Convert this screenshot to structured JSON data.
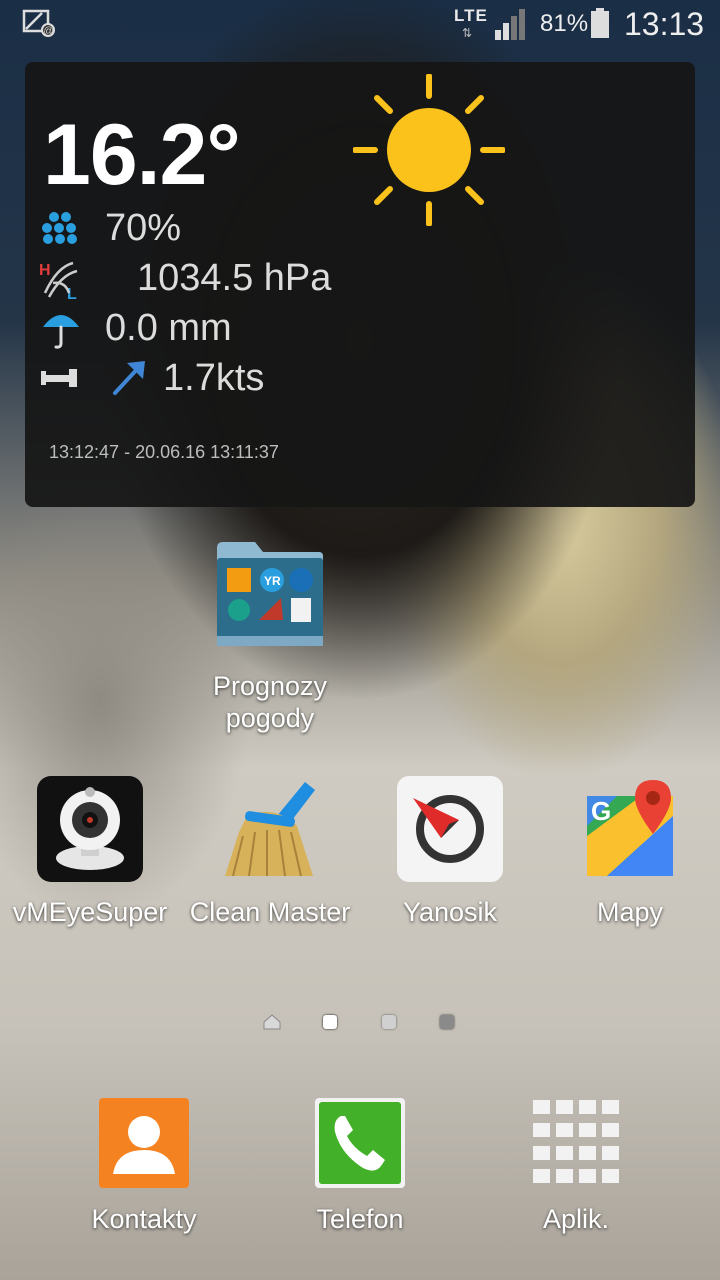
{
  "status_bar": {
    "network": "LTE",
    "network_arrows": "⇅",
    "battery_percent": "81%",
    "time": "13:13",
    "left_icon": "screen-mirroring-icon"
  },
  "weather_widget": {
    "temperature": "16.2°",
    "weather_icon": "sun-icon",
    "humidity": "70%",
    "pressure": "1034.5 hPa",
    "rain": "0.0 mm",
    "wind": "1.7kts",
    "footer": "13:12:47 - 20.06.16 13:11:37"
  },
  "home_folder": {
    "label_line1": "Prognozy",
    "label_line2": "pogody"
  },
  "apps": [
    {
      "label": "vMEyeSuper",
      "icon": "webcam-icon"
    },
    {
      "label": "Clean Master",
      "icon": "broom-icon"
    },
    {
      "label": "Yanosik",
      "icon": "yanosik-compass-icon"
    },
    {
      "label": "Mapy",
      "icon": "google-maps-icon"
    }
  ],
  "page_indicator": {
    "pages": 4,
    "current": 2
  },
  "dock": [
    {
      "label": "Kontakty",
      "icon": "contacts-icon"
    },
    {
      "label": "Telefon",
      "icon": "phone-icon"
    },
    {
      "label": "Aplik.",
      "icon": "apps-grid-icon"
    }
  ]
}
